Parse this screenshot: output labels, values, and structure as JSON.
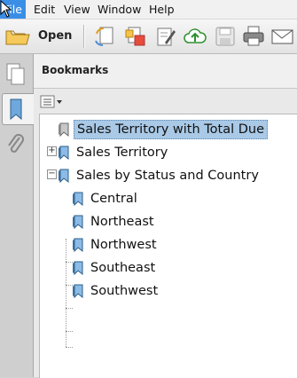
{
  "menubar": {
    "items": [
      {
        "label": "File",
        "active": true
      },
      {
        "label": "Edit",
        "active": false
      },
      {
        "label": "View",
        "active": false
      },
      {
        "label": "Window",
        "active": false
      },
      {
        "label": "Help",
        "active": false
      }
    ]
  },
  "toolbar": {
    "open_label": "Open",
    "icons": [
      "open-folder-icon",
      "create-icon",
      "convert-icon",
      "edit-icon",
      "upload-cloud-icon",
      "save-icon",
      "print-icon",
      "email-icon"
    ]
  },
  "rail": {
    "icons": [
      "pages-icon",
      "bookmarks-icon",
      "attachments-icon"
    ]
  },
  "panel": {
    "title": "Bookmarks",
    "options_icon": "options-menu-icon"
  },
  "bookmarks": [
    {
      "label": "Sales Territory with Total Due",
      "level": 0,
      "selected": true,
      "expander": null
    },
    {
      "label": "Sales Territory",
      "level": 0,
      "selected": false,
      "expander": "+"
    },
    {
      "label": "Sales by Status and Country",
      "level": 0,
      "selected": false,
      "expander": "−"
    },
    {
      "label": "Central",
      "level": 1,
      "selected": false,
      "expander": null
    },
    {
      "label": "Northeast",
      "level": 1,
      "selected": false,
      "expander": null
    },
    {
      "label": "Northwest",
      "level": 1,
      "selected": false,
      "expander": null
    },
    {
      "label": "Southeast",
      "level": 1,
      "selected": false,
      "expander": null
    },
    {
      "label": "Southwest",
      "level": 1,
      "selected": false,
      "expander": null
    }
  ],
  "colors": {
    "selection": "#a9c9e6",
    "menu_active": "#3a8ee6"
  }
}
